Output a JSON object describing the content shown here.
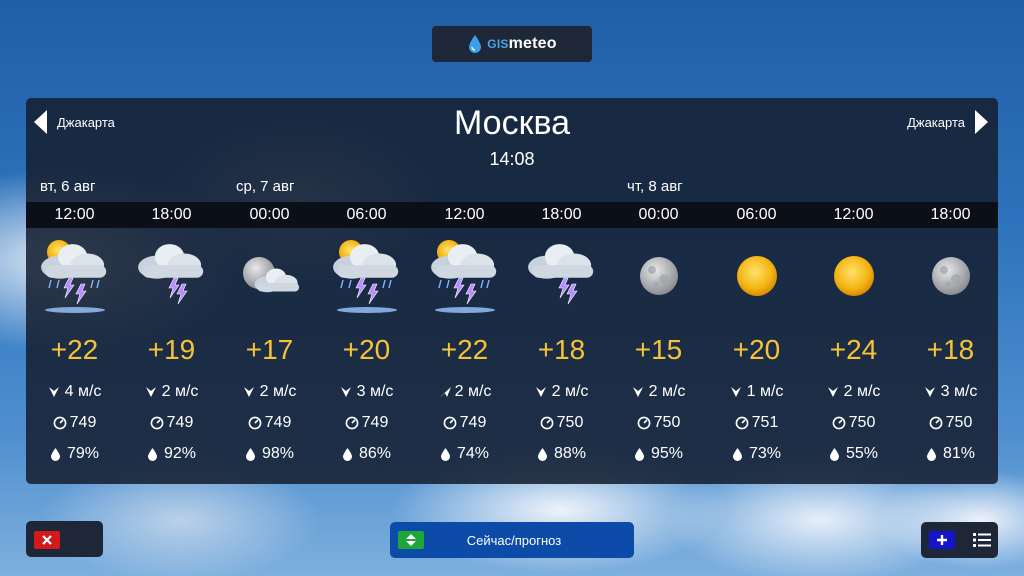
{
  "brand": {
    "logo_gis": "GIS",
    "logo_meteo": "meteo"
  },
  "nav": {
    "prev_city": "Джакарта",
    "next_city": "Джакарта"
  },
  "city": "Москва",
  "current_time": "14:08",
  "days": [
    "вт, 6 авг",
    "ср, 7 авг",
    "чт, 8 авг"
  ],
  "forecast": [
    {
      "hour": "12:00",
      "icon": "thunderstorm-rain-sun-icon",
      "temp": "+22",
      "wind": "4 м/с",
      "wind_dir": "north-icon",
      "pressure": "749",
      "humidity": "79%"
    },
    {
      "hour": "18:00",
      "icon": "thunderstorm-cloud-icon",
      "temp": "+19",
      "wind": "2 м/с",
      "wind_dir": "north-icon",
      "pressure": "749",
      "humidity": "92%"
    },
    {
      "hour": "00:00",
      "icon": "moon-cloud-icon",
      "temp": "+17",
      "wind": "2 м/с",
      "wind_dir": "north-icon",
      "pressure": "749",
      "humidity": "98%"
    },
    {
      "hour": "06:00",
      "icon": "thunderstorm-rain-sun-icon",
      "temp": "+20",
      "wind": "3 м/с",
      "wind_dir": "north-icon",
      "pressure": "749",
      "humidity": "86%"
    },
    {
      "hour": "12:00",
      "icon": "thunderstorm-rain-sun-icon",
      "temp": "+22",
      "wind": "2 м/с",
      "wind_dir": "north-east-icon",
      "pressure": "749",
      "humidity": "74%"
    },
    {
      "hour": "18:00",
      "icon": "thunderstorm-cloud-icon",
      "temp": "+18",
      "wind": "2 м/с",
      "wind_dir": "north-icon",
      "pressure": "750",
      "humidity": "88%"
    },
    {
      "hour": "00:00",
      "icon": "moon-icon",
      "temp": "+15",
      "wind": "2 м/с",
      "wind_dir": "north-icon",
      "pressure": "750",
      "humidity": "95%"
    },
    {
      "hour": "06:00",
      "icon": "sun-icon",
      "temp": "+20",
      "wind": "1 м/с",
      "wind_dir": "north-icon",
      "pressure": "751",
      "humidity": "73%"
    },
    {
      "hour": "12:00",
      "icon": "sun-icon",
      "temp": "+24",
      "wind": "2 м/с",
      "wind_dir": "north-icon",
      "pressure": "750",
      "humidity": "55%"
    },
    {
      "hour": "18:00",
      "icon": "moon-icon",
      "temp": "+18",
      "wind": "3 м/с",
      "wind_dir": "north-icon",
      "pressure": "750",
      "humidity": "81%"
    }
  ],
  "buttons": {
    "toggle_label": "Сейчас/прогноз"
  },
  "colors": {
    "temp": "#f6c23a",
    "close": "#d21a1a",
    "toggle": "#0c4ba8",
    "toggle_switch": "#1ea63a",
    "add": "#1414c8"
  }
}
